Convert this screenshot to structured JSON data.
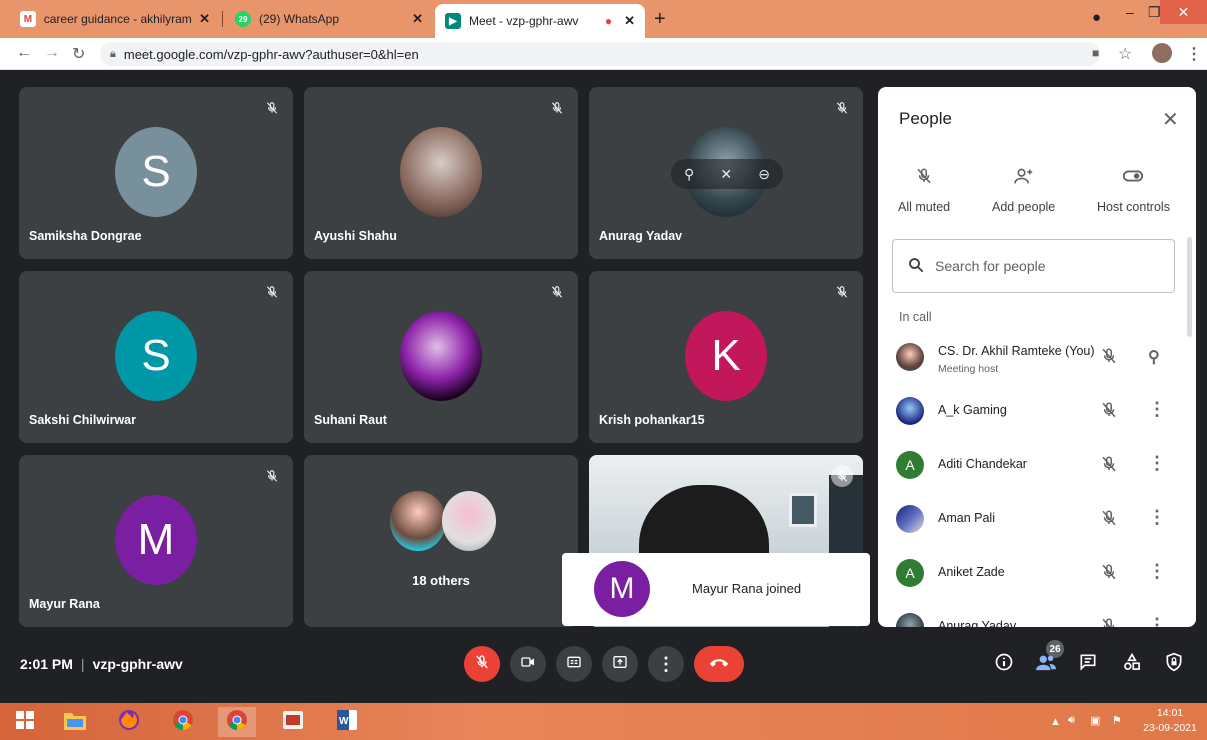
{
  "browser": {
    "tabs": [
      {
        "title": "career guidance - akhilyramteke",
        "favicon": "gmail-icon"
      },
      {
        "title": "(29) WhatsApp",
        "favicon": "whatsapp-icon",
        "badge": "29"
      },
      {
        "title": "Meet - vzp-gphr-awv",
        "favicon": "meet-icon",
        "active": true
      }
    ],
    "url": "meet.google.com/vzp-gphr-awv?authuser=0&hl=en"
  },
  "tiles": [
    {
      "name": "Samiksha Dongrae",
      "initial": "S",
      "color": "#78909c",
      "muted": true
    },
    {
      "name": "Ayushi Shahu",
      "muted": true
    },
    {
      "name": "Anurag Yadav",
      "muted": true
    },
    {
      "name": "Sakshi Chilwirwar",
      "initial": "S",
      "color": "#0097a7",
      "muted": true
    },
    {
      "name": "Suhani Raut",
      "muted": true
    },
    {
      "name": "Krish pohankar15",
      "initial": "K",
      "color": "#c2185b",
      "muted": true
    },
    {
      "name": "Mayur Rana",
      "initial": "M",
      "color": "#7b1fa2",
      "muted": true
    },
    {
      "name": "18 others"
    }
  ],
  "toast": {
    "initial": "M",
    "text": "Mayur Rana joined",
    "color": "#7b1fa2"
  },
  "people_panel": {
    "title": "People",
    "actions": [
      {
        "label": "All muted",
        "icon": "mic-off-icon"
      },
      {
        "label": "Add people",
        "icon": "add-person-icon"
      },
      {
        "label": "Host controls",
        "icon": "toggle-icon"
      }
    ],
    "search_placeholder": "Search for people",
    "section_label": "In call",
    "people": [
      {
        "name": "CS. Dr. Akhil Ramteke (You)",
        "sub": "Meeting host"
      },
      {
        "name": "A_k Gaming"
      },
      {
        "name": "Aditi Chandekar",
        "initial": "A",
        "color": "#2e7d32"
      },
      {
        "name": "Aman Pali"
      },
      {
        "name": "Aniket Zade",
        "initial": "A",
        "color": "#2e7d32"
      },
      {
        "name": "Anurag Yadav"
      }
    ]
  },
  "meeting": {
    "time": "2:01 PM",
    "code": "vzp-gphr-awv",
    "participant_count": "26"
  },
  "taskbar": {
    "time": "14:01",
    "date": "23-09-2021"
  }
}
